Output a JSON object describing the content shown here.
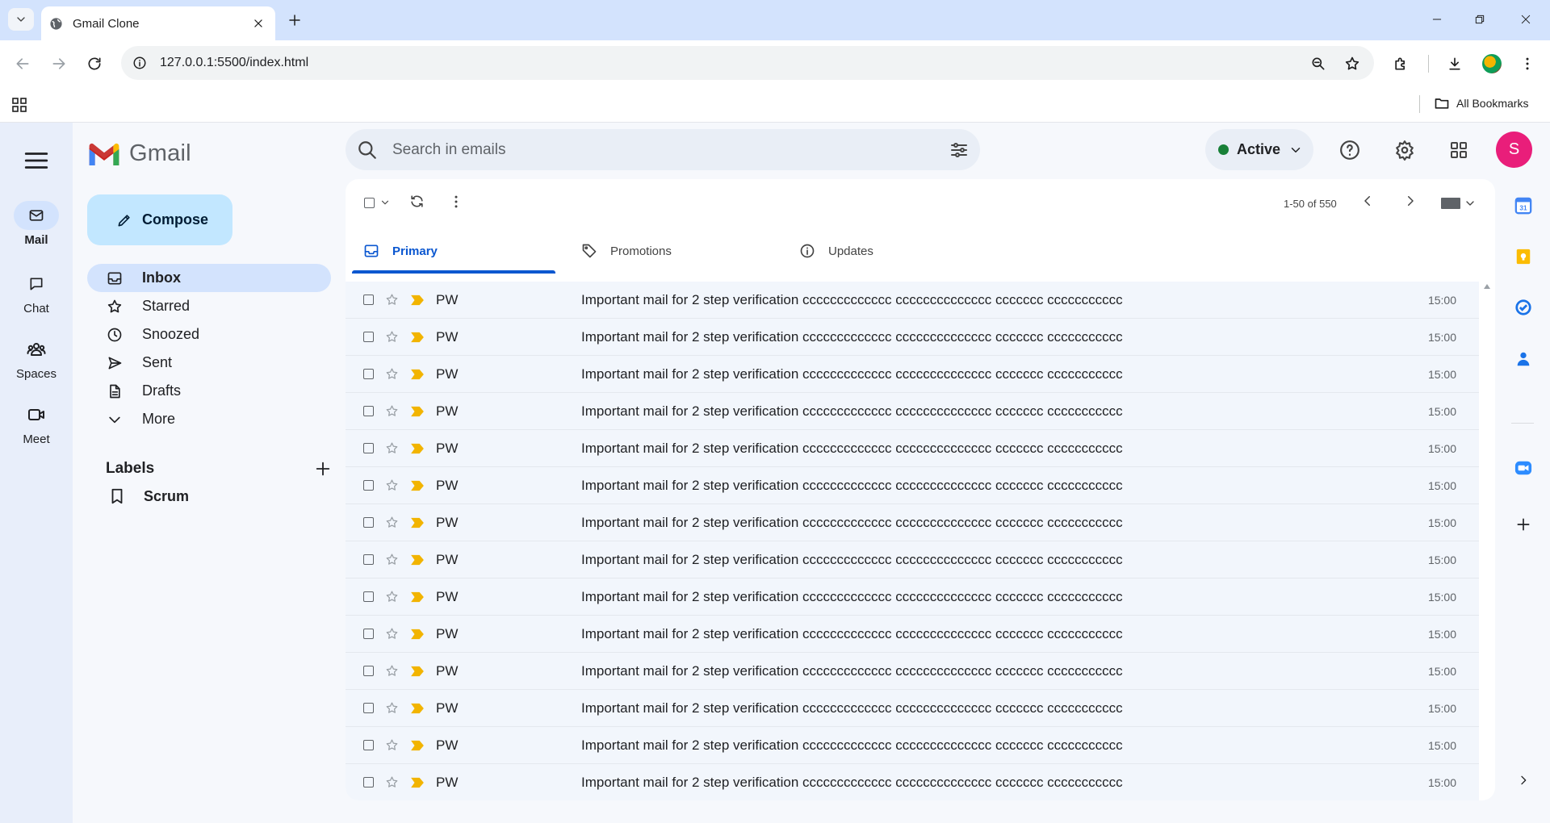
{
  "browser": {
    "tab_title": "Gmail Clone",
    "url": "127.0.0.1:5500/index.html",
    "all_bookmarks": "All Bookmarks"
  },
  "rail": {
    "items": [
      {
        "label": "Mail",
        "icon": "mail-icon",
        "active": true
      },
      {
        "label": "Chat",
        "icon": "chat-icon"
      },
      {
        "label": "Spaces",
        "icon": "spaces-icon"
      },
      {
        "label": "Meet",
        "icon": "meet-icon"
      }
    ]
  },
  "brand": "Gmail",
  "compose_label": "Compose",
  "nav": [
    {
      "label": "Inbox",
      "icon": "inbox-icon",
      "active": true
    },
    {
      "label": "Starred",
      "icon": "star-icon"
    },
    {
      "label": "Snoozed",
      "icon": "clock-icon"
    },
    {
      "label": "Sent",
      "icon": "send-icon"
    },
    {
      "label": "Drafts",
      "icon": "draft-icon"
    },
    {
      "label": "More",
      "icon": "chevron-down-icon"
    }
  ],
  "labels": {
    "title": "Labels",
    "items": [
      {
        "label": "Scrum",
        "icon": "label-icon"
      }
    ]
  },
  "search": {
    "placeholder": "Search in emails"
  },
  "status": {
    "label": "Active",
    "color": "#188038"
  },
  "avatar_letter": "S",
  "avatar_color": "#e91e7a",
  "pager": "1-50 of 550",
  "tabs": [
    {
      "label": "Primary",
      "icon": "inbox-icon",
      "active": true
    },
    {
      "label": "Promotions",
      "icon": "tag-icon"
    },
    {
      "label": "Updates",
      "icon": "info-icon"
    }
  ],
  "emails": [
    {
      "sender": "PW",
      "subject": "Important mail for 2 step verification ccccccccccccc cccccccccccccc ccccccc ccccccccccc",
      "time": "15:00"
    },
    {
      "sender": "PW",
      "subject": "Important mail for 2 step verification ccccccccccccc cccccccccccccc ccccccc ccccccccccc",
      "time": "15:00"
    },
    {
      "sender": "PW",
      "subject": "Important mail for 2 step verification ccccccccccccc cccccccccccccc ccccccc ccccccccccc",
      "time": "15:00"
    },
    {
      "sender": "PW",
      "subject": "Important mail for 2 step verification ccccccccccccc cccccccccccccc ccccccc ccccccccccc",
      "time": "15:00"
    },
    {
      "sender": "PW",
      "subject": "Important mail for 2 step verification ccccccccccccc cccccccccccccc ccccccc ccccccccccc",
      "time": "15:00"
    },
    {
      "sender": "PW",
      "subject": "Important mail for 2 step verification ccccccccccccc cccccccccccccc ccccccc ccccccccccc",
      "time": "15:00"
    },
    {
      "sender": "PW",
      "subject": "Important mail for 2 step verification ccccccccccccc cccccccccccccc ccccccc ccccccccccc",
      "time": "15:00"
    },
    {
      "sender": "PW",
      "subject": "Important mail for 2 step verification ccccccccccccc cccccccccccccc ccccccc ccccccccccc",
      "time": "15:00"
    },
    {
      "sender": "PW",
      "subject": "Important mail for 2 step verification ccccccccccccc cccccccccccccc ccccccc ccccccccccc",
      "time": "15:00"
    },
    {
      "sender": "PW",
      "subject": "Important mail for 2 step verification ccccccccccccc cccccccccccccc ccccccc ccccccccccc",
      "time": "15:00"
    },
    {
      "sender": "PW",
      "subject": "Important mail for 2 step verification ccccccccccccc cccccccccccccc ccccccc ccccccccccc",
      "time": "15:00"
    },
    {
      "sender": "PW",
      "subject": "Important mail for 2 step verification ccccccccccccc cccccccccccccc ccccccc ccccccccccc",
      "time": "15:00"
    },
    {
      "sender": "PW",
      "subject": "Important mail for 2 step verification ccccccccccccc cccccccccccccc ccccccc ccccccccccc",
      "time": "15:00"
    },
    {
      "sender": "PW",
      "subject": "Important mail for 2 step verification ccccccccccccc cccccccccccccc ccccccc ccccccccccc",
      "time": "15:00"
    }
  ],
  "side_panel": [
    "calendar-icon",
    "keep-icon",
    "tasks-icon",
    "contacts-icon",
    "zoom-icon",
    "add-icon",
    "chevron-right-icon"
  ],
  "colors": {
    "accent": "#0b57d0",
    "important": "#f2b400",
    "compose_bg": "#c2e7ff"
  }
}
